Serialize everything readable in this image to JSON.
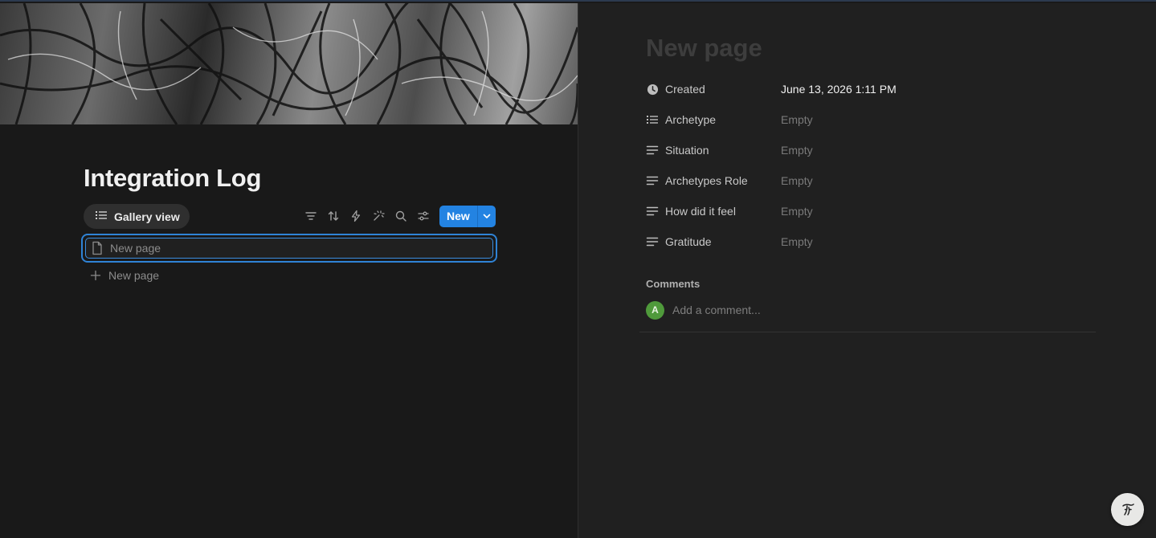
{
  "left": {
    "title": "Integration Log",
    "view_tab": {
      "label": "Gallery view",
      "icon": "list-icon"
    },
    "toolbar": {
      "icons": [
        "filter-icon",
        "sort-icon",
        "automation-icon",
        "ai-icon",
        "search-icon",
        "settings-icon"
      ],
      "new_label": "New"
    },
    "rows": [
      {
        "title_placeholder": "New page",
        "icon": "page-icon",
        "selected": true
      }
    ],
    "add_row_label": "New page"
  },
  "right": {
    "title_placeholder": "New page",
    "properties": [
      {
        "name": "Created",
        "value": "June 13, 2026 1:11 PM",
        "icon": "clock-icon",
        "filled": true
      },
      {
        "name": "Archetype",
        "value": "Empty",
        "icon": "list-icon",
        "filled": false
      },
      {
        "name": "Situation",
        "value": "Empty",
        "icon": "text-icon",
        "filled": false
      },
      {
        "name": "Archetypes Role",
        "value": "Empty",
        "icon": "text-icon",
        "filled": false
      },
      {
        "name": "How did it feel",
        "value": "Empty",
        "icon": "text-icon",
        "filled": false
      },
      {
        "name": "Gratitude",
        "value": "Empty",
        "icon": "text-icon",
        "filled": false
      }
    ],
    "comments": {
      "label": "Comments",
      "avatar_initial": "A",
      "placeholder": "Add a comment..."
    }
  },
  "colors": {
    "accent": "#2383e2",
    "avatar": "#4f9a3b"
  }
}
